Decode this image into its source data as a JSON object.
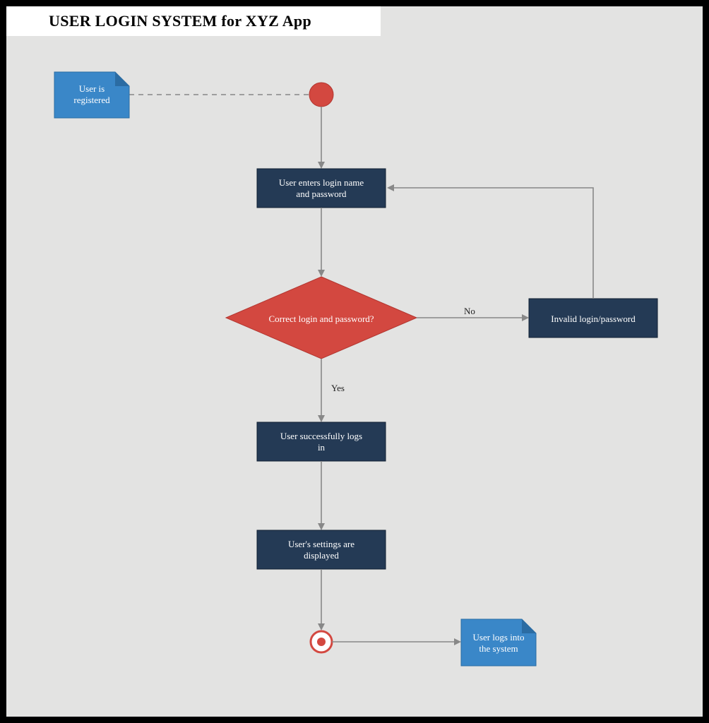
{
  "title": "USER LOGIN SYSTEM for XYZ App",
  "nodes": {
    "note_registered": {
      "line1": "User is",
      "line2": "registered"
    },
    "enter_credentials": {
      "line1": "User enters login name",
      "line2": "and password"
    },
    "decision": {
      "text": "Correct login and password?"
    },
    "invalid": {
      "text": "Invalid login/password"
    },
    "success": {
      "line1": "User successfully logs",
      "line2": "in"
    },
    "settings": {
      "line1": "User's settings are",
      "line2": "displayed"
    },
    "note_logged_in": {
      "line1": "User logs into",
      "line2": "the system"
    }
  },
  "edges": {
    "no_label": "No",
    "yes_label": "Yes"
  },
  "colors": {
    "dark_box": "#243a55",
    "diamond": "#d34840",
    "blue_note": "#3a87c8",
    "connector": "#888888",
    "canvas": "#e3e3e2"
  }
}
